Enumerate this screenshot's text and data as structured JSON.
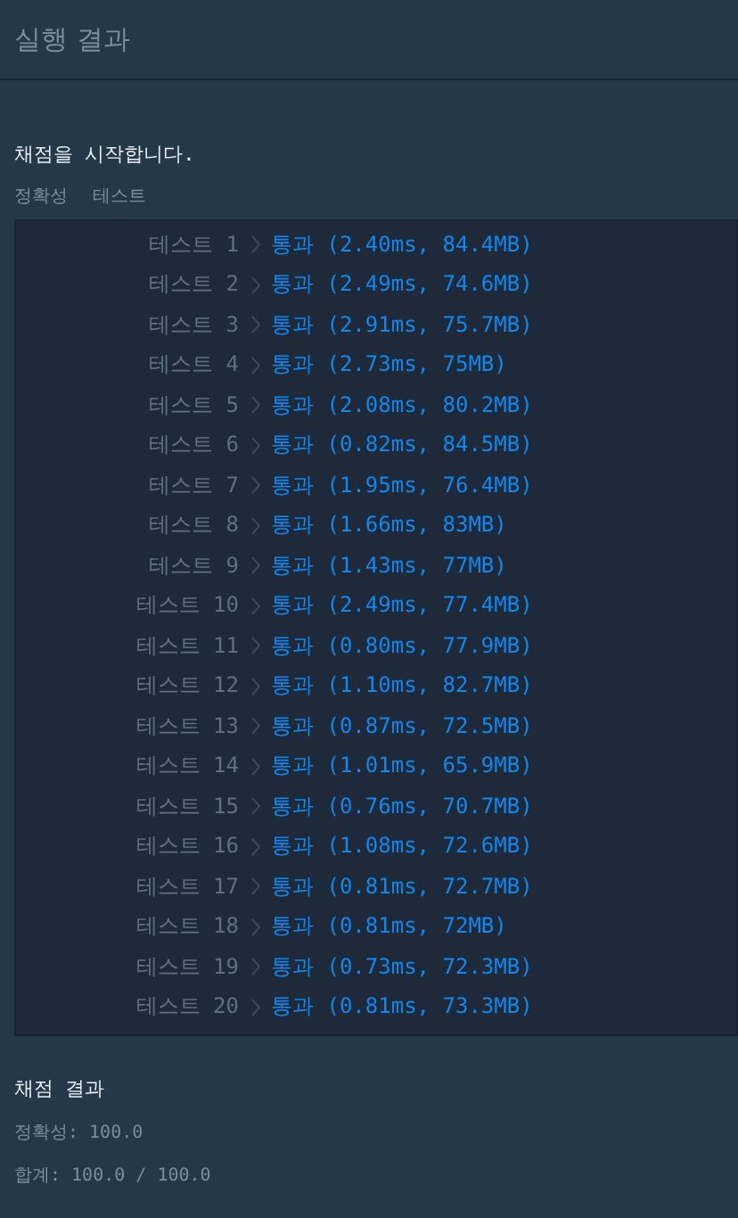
{
  "header": {
    "title": "실행 결과"
  },
  "intro": "채점을 시작합니다.",
  "section_labels": [
    "정확성",
    "테스트"
  ],
  "tests": [
    {
      "label": "테스트 1",
      "result": "통과 (2.40ms, 84.4MB)"
    },
    {
      "label": "테스트 2",
      "result": "통과 (2.49ms, 74.6MB)"
    },
    {
      "label": "테스트 3",
      "result": "통과 (2.91ms, 75.7MB)"
    },
    {
      "label": "테스트 4",
      "result": "통과 (2.73ms, 75MB)"
    },
    {
      "label": "테스트 5",
      "result": "통과 (2.08ms, 80.2MB)"
    },
    {
      "label": "테스트 6",
      "result": "통과 (0.82ms, 84.5MB)"
    },
    {
      "label": "테스트 7",
      "result": "통과 (1.95ms, 76.4MB)"
    },
    {
      "label": "테스트 8",
      "result": "통과 (1.66ms, 83MB)"
    },
    {
      "label": "테스트 9",
      "result": "통과 (1.43ms, 77MB)"
    },
    {
      "label": "테스트 10",
      "result": "통과 (2.49ms, 77.4MB)"
    },
    {
      "label": "테스트 11",
      "result": "통과 (0.80ms, 77.9MB)"
    },
    {
      "label": "테스트 12",
      "result": "통과 (1.10ms, 82.7MB)"
    },
    {
      "label": "테스트 13",
      "result": "통과 (0.87ms, 72.5MB)"
    },
    {
      "label": "테스트 14",
      "result": "통과 (1.01ms, 65.9MB)"
    },
    {
      "label": "테스트 15",
      "result": "통과 (0.76ms, 70.7MB)"
    },
    {
      "label": "테스트 16",
      "result": "통과 (1.08ms, 72.6MB)"
    },
    {
      "label": "테스트 17",
      "result": "통과 (0.81ms, 72.7MB)"
    },
    {
      "label": "테스트 18",
      "result": "통과 (0.81ms, 72MB)"
    },
    {
      "label": "테스트 19",
      "result": "통과 (0.73ms, 72.3MB)"
    },
    {
      "label": "테스트 20",
      "result": "통과 (0.81ms, 73.3MB)"
    }
  ],
  "summary": {
    "title": "채점 결과",
    "lines": [
      "정확성: 100.0",
      "합계: 100.0 / 100.0"
    ]
  }
}
